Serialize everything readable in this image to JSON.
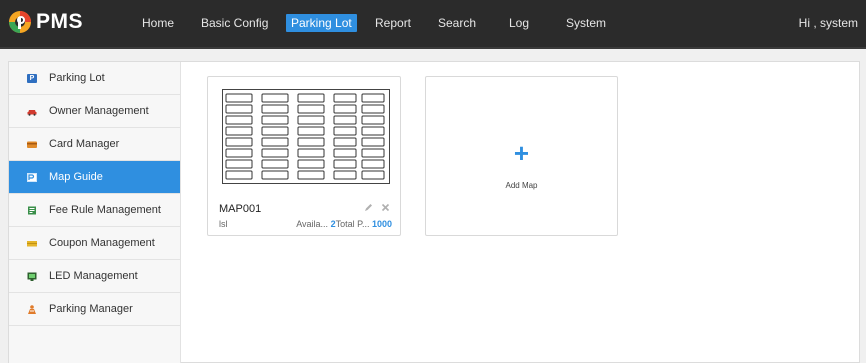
{
  "app": {
    "logo_text": "PMS"
  },
  "nav": {
    "items": [
      {
        "label": "Home"
      },
      {
        "label": "Basic Config"
      },
      {
        "label": "Parking Lot",
        "active": true
      },
      {
        "label": "Report"
      },
      {
        "label": "Search"
      },
      {
        "label": "Log"
      },
      {
        "label": "System"
      }
    ],
    "greeting": "Hi , system"
  },
  "sidebar": {
    "items": [
      {
        "label": "Parking Lot",
        "icon": "parking-p-icon",
        "color": "#2f6fc0"
      },
      {
        "label": "Owner Management",
        "icon": "car-icon",
        "color": "#d23b2f"
      },
      {
        "label": "Card Manager",
        "icon": "card-icon",
        "color": "#e08a2a"
      },
      {
        "label": "Map Guide",
        "icon": "map-icon",
        "color": "#2f8fe0",
        "active": true
      },
      {
        "label": "Fee Rule Management",
        "icon": "fee-icon",
        "color": "#3a8f4a"
      },
      {
        "label": "Coupon Management",
        "icon": "coupon-icon",
        "color": "#e5b52a"
      },
      {
        "label": "LED Management",
        "icon": "led-icon",
        "color": "#2e5f2e"
      },
      {
        "label": "Parking Manager",
        "icon": "person-icon",
        "color": "#e07b2a"
      }
    ]
  },
  "maps": [
    {
      "name": "MAP001",
      "subtitle": "lsl",
      "available_label": "Availa...",
      "available_value": "2",
      "total_label": "Total P...",
      "total_value": "1000"
    }
  ],
  "add_card": {
    "symbol": "+",
    "label": "Add Map"
  },
  "colors": {
    "accent": "#2f8fe0",
    "topbar": "#2b2b2b"
  }
}
